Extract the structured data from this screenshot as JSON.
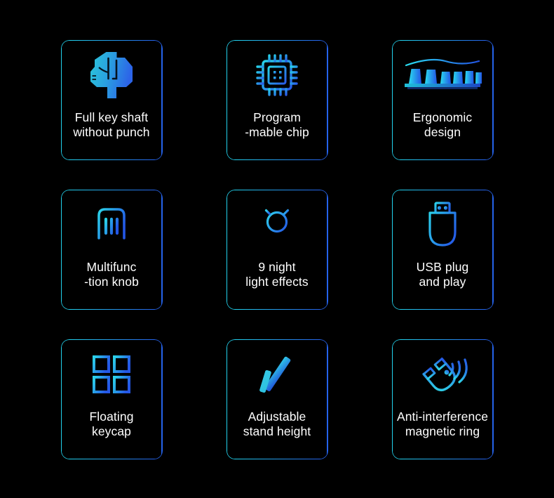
{
  "theme": {
    "background": "#000000",
    "gradient_start": "#22D3EE",
    "gradient_end": "#2563EB",
    "text_color": "#FFFFFF"
  },
  "cards": [
    {
      "id": "full-key-shaft",
      "icon": "key-switch-icon",
      "label": "Full key shaft\nwithout punch",
      "line1": "Full key shaft",
      "line2": "without punch"
    },
    {
      "id": "programmable-chip",
      "icon": "chip-icon",
      "label": "Program\n-mable chip",
      "line1": "Program",
      "line2": "-mable chip"
    },
    {
      "id": "ergonomic-design",
      "icon": "ergonomic-keys-icon",
      "label": "Ergonomic\ndesign",
      "line1": "Ergonomic",
      "line2": "design"
    },
    {
      "id": "multifunction-knob",
      "icon": "knob-icon",
      "label": "Multifunc\n-tion knob",
      "line1": "Multifunc",
      "line2": "-tion knob"
    },
    {
      "id": "night-light-effects",
      "icon": "lightbulb-icon",
      "label": "9 night\nlight effects",
      "line1": "9 night",
      "line2": "light effects"
    },
    {
      "id": "usb-plug-and-play",
      "icon": "usb-drive-icon",
      "label": "USB plug\nand play",
      "line1": "USB plug",
      "line2": "and play"
    },
    {
      "id": "floating-keycap",
      "icon": "four-squares-icon",
      "label": "Floating\nkeycap",
      "line1": "Floating",
      "line2": "keycap"
    },
    {
      "id": "adjustable-stand-height",
      "icon": "stand-bars-icon",
      "label": "Adjustable\nstand height",
      "line1": "Adjustable",
      "line2": "stand height"
    },
    {
      "id": "anti-interference-magnetic-ring",
      "icon": "magnet-signal-icon",
      "label": "Anti-interference\nmagnetic ring",
      "line1": "Anti-interference",
      "line2": "magnetic ring"
    }
  ]
}
